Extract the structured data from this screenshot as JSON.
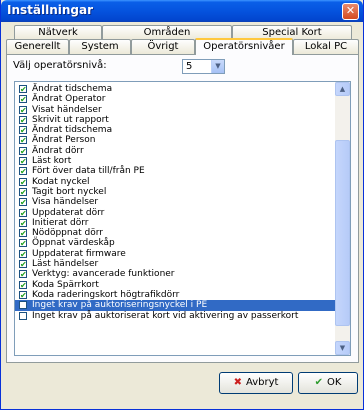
{
  "window": {
    "title": "Inställningar"
  },
  "tabs": {
    "top_row": [
      {
        "label": "Nätverk"
      },
      {
        "label": "Områden"
      },
      {
        "label": "Special Kort"
      }
    ],
    "bottom_row": [
      {
        "label": "Generellt"
      },
      {
        "label": "System"
      },
      {
        "label": "Övrigt"
      },
      {
        "label": "Operatörsnivåer",
        "active": true
      },
      {
        "label": "Lokal PC"
      }
    ]
  },
  "operator_level": {
    "label": "Välj operatörsnivå:",
    "value": "5"
  },
  "permissions": [
    {
      "label": "Ändrat tidschema",
      "checked": true
    },
    {
      "label": "Ändrat Operator",
      "checked": true
    },
    {
      "label": "Visat händelser",
      "checked": true
    },
    {
      "label": "Skrivit ut rapport",
      "checked": true
    },
    {
      "label": "Ändrat tidschema",
      "checked": true
    },
    {
      "label": "Ändrat Person",
      "checked": true
    },
    {
      "label": "Ändrat dörr",
      "checked": true
    },
    {
      "label": "Läst kort",
      "checked": true
    },
    {
      "label": "Fört över data till/från PE",
      "checked": true
    },
    {
      "label": "Kodat nyckel",
      "checked": true
    },
    {
      "label": "Tagit bort nyckel",
      "checked": true
    },
    {
      "label": "Visa händelser",
      "checked": true
    },
    {
      "label": "Uppdaterat dörr",
      "checked": true
    },
    {
      "label": "Initierat dörr",
      "checked": true
    },
    {
      "label": "Nödöppnat dörr",
      "checked": true
    },
    {
      "label": "Öppnat värdeskåp",
      "checked": true
    },
    {
      "label": "Uppdaterat firmware",
      "checked": true
    },
    {
      "label": "Läst händelser",
      "checked": true
    },
    {
      "label": "Verktyg: avancerade funktioner",
      "checked": true
    },
    {
      "label": "Koda Spärrkort",
      "checked": true
    },
    {
      "label": "Koda raderingskort högtrafikdörr",
      "checked": true
    },
    {
      "label": "Inget krav på auktoriseringsnyckel i PE",
      "checked": false,
      "selected": true
    },
    {
      "label": "Inget krav på auktoriserat kort vid aktivering av passerkort",
      "checked": false
    }
  ],
  "buttons": {
    "cancel": {
      "label": "Avbryt",
      "icon": "x-icon",
      "color": "#cc1f1f"
    },
    "ok": {
      "label": "OK",
      "icon": "check-icon",
      "color": "#2e9c2e"
    }
  }
}
